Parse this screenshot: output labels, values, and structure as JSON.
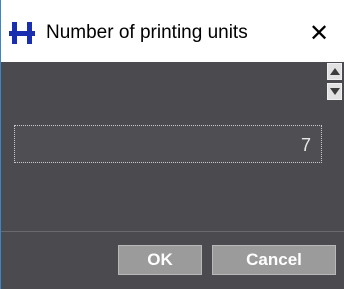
{
  "window": {
    "title": "Number of printing units",
    "close_glyph": "✕",
    "app_icon": "h-logo-icon",
    "icon_color": "#1a2fb0"
  },
  "field": {
    "value": "7"
  },
  "buttons": {
    "ok_label": "OK",
    "cancel_label": "Cancel"
  },
  "colors": {
    "panel_bg": "#4b4b4f",
    "button_bg": "#9b9b9b"
  }
}
